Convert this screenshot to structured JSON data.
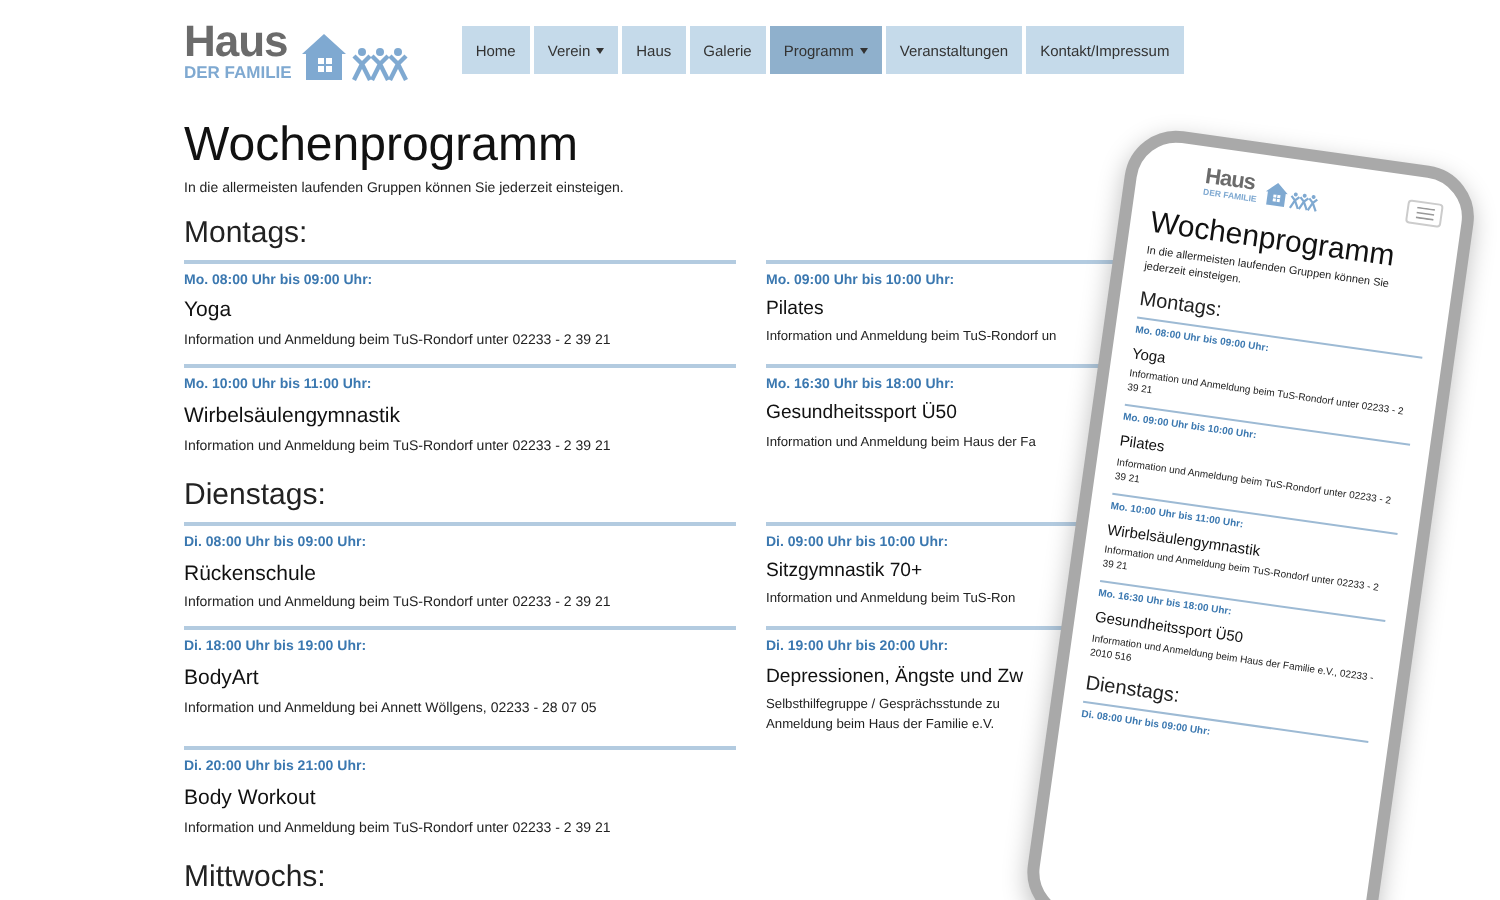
{
  "logo": {
    "title": "Haus",
    "subtitle": "DER FAMILIE"
  },
  "nav": [
    {
      "label": "Home",
      "dropdown": false,
      "selected": false
    },
    {
      "label": "Verein",
      "dropdown": true,
      "selected": false
    },
    {
      "label": "Haus",
      "dropdown": false,
      "selected": false
    },
    {
      "label": "Galerie",
      "dropdown": false,
      "selected": false
    },
    {
      "label": "Programm",
      "dropdown": true,
      "selected": true
    },
    {
      "label": "Veranstaltungen",
      "dropdown": false,
      "selected": false
    },
    {
      "label": "Kontakt/Impressum",
      "dropdown": false,
      "selected": false
    }
  ],
  "page": {
    "title": "Wochenprogramm",
    "intro": "In die allermeisten laufenden Gruppen können Sie jederzeit einsteigen.",
    "days": [
      {
        "name": "Montags:",
        "rows": [
          [
            {
              "time": "Mo. 08:00 Uhr bis 09:00 Uhr:",
              "title": "Yoga",
              "info": [
                "Information und Anmeldung beim TuS-Rondorf unter 02233 - 2 39 21"
              ]
            },
            {
              "time": "Mo. 09:00 Uhr bis 10:00 Uhr:",
              "title": "Pilates",
              "info": [
                "Information und Anmeldung beim TuS-Rondorf un"
              ]
            }
          ],
          [
            {
              "time": "Mo. 10:00 Uhr bis 11:00 Uhr:",
              "title": "Wirbelsäulengymnastik",
              "info": [
                "Information und Anmeldung beim TuS-Rondorf unter 02233 - 2 39 21"
              ]
            },
            {
              "time": "Mo. 16:30 Uhr bis 18:00 Uhr:",
              "title": "Gesundheitssport Ü50",
              "info": [
                "Information und Anmeldung beim Haus der Fa"
              ]
            }
          ]
        ]
      },
      {
        "name": "Dienstags:",
        "rows": [
          [
            {
              "time": "Di. 08:00 Uhr bis 09:00 Uhr:",
              "title": "Rückenschule",
              "info": [
                "Information und Anmeldung beim TuS-Rondorf unter 02233 - 2 39 21"
              ]
            },
            {
              "time": "Di. 09:00 Uhr bis 10:00 Uhr:",
              "title": "Sitzgymnastik 70+",
              "info": [
                "Information und Anmeldung beim TuS-Ron"
              ]
            }
          ],
          [
            {
              "time": "Di. 18:00 Uhr bis 19:00 Uhr:",
              "title": "BodyArt",
              "info": [
                "Information und Anmeldung bei Annett Wöllgens, 02233 - 28 07 05"
              ]
            },
            {
              "time": "Di. 19:00 Uhr bis 20:00 Uhr:",
              "title": "Depressionen, Ängste und Zw",
              "info": [
                "Selbsthilfegruppe / Gesprächsstunde zu",
                "Anmeldung beim Haus der Familie e.V."
              ]
            }
          ],
          [
            {
              "time": "Di. 20:00 Uhr bis 21:00 Uhr:",
              "title": "Body Workout",
              "info": [
                "Information und Anmeldung beim TuS-Rondorf unter 02233 - 2 39 21"
              ]
            }
          ]
        ]
      },
      {
        "name": "Mittwochs:"
      }
    ]
  },
  "phone": {
    "logo": {
      "title": "Haus",
      "subtitle": "DER FAMILIE"
    },
    "title": "Wochenprogramm",
    "intro": "In die allermeisten laufenden Gruppen können Sie jederzeit einsteigen.",
    "days": [
      {
        "name": "Montags:",
        "entries": [
          {
            "time": "Mo. 08:00 Uhr bis 09:00 Uhr:",
            "title": "Yoga",
            "info": "Information und Anmeldung beim TuS-Rondorf unter 02233 - 2 39 21"
          },
          {
            "time": "Mo. 09:00 Uhr bis 10:00 Uhr:",
            "title": "Pilates",
            "info": "Information und Anmeldung beim TuS-Rondorf unter 02233 - 2 39 21"
          },
          {
            "time": "Mo. 10:00 Uhr bis 11:00 Uhr:",
            "title": "Wirbelsäulengymnastik",
            "info": "Information und Anmeldung beim TuS-Rondorf unter 02233 - 2 39 21"
          },
          {
            "time": "Mo. 16:30 Uhr bis 18:00 Uhr:",
            "title": "Gesundheitssport Ü50",
            "info": "Information und Anmeldung beim Haus der Familie e.V., 02233 - 2010 516"
          }
        ]
      },
      {
        "name": "Dienstags:",
        "entries": [
          {
            "time": "Di. 08:00 Uhr bis 09:00 Uhr:"
          }
        ]
      }
    ]
  }
}
